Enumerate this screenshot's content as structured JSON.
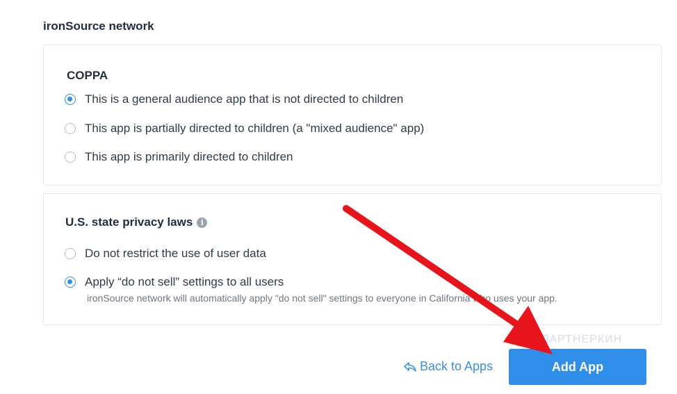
{
  "network_title": "ironSource network",
  "coppa": {
    "heading": "COPPA",
    "options": [
      {
        "label": "This is a general audience app that is not directed to children",
        "checked": true
      },
      {
        "label": "This app is partially directed to children (a \"mixed audience\" app)",
        "checked": false
      },
      {
        "label": "This app is primarily directed to children",
        "checked": false
      }
    ]
  },
  "privacy": {
    "heading": "U.S. state privacy laws",
    "info_icon": "info-icon",
    "options": [
      {
        "label": "Do not restrict the use of user data",
        "checked": false
      },
      {
        "label": "Apply “do not sell” settings to all users",
        "checked": true
      }
    ],
    "hint": "ironSource network will automatically apply \"do not sell\" settings to everyone in California who uses your app."
  },
  "footer": {
    "back_label": "Back to Apps",
    "back_icon": "back-arrow-icon",
    "add_label": "Add App"
  },
  "watermark": "ПАРТНЕРКИН",
  "colors": {
    "accent": "#2f8fe8",
    "annotation_arrow": "#e8141b"
  }
}
